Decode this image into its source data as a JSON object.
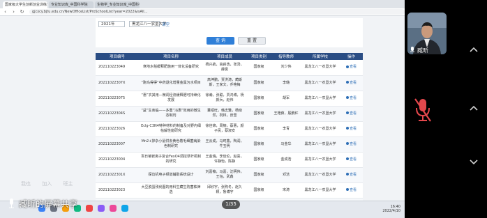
{
  "browser": {
    "tabs": [
      {
        "label": "国家级大学生创新创业训练计划"
      },
      {
        "label": "专业知识库_中国科学院"
      },
      {
        "label": "生物学_专业知识库_中国科学院"
      }
    ],
    "url": "gjcxcy.bjtu.edu.cn/NewOfficeList/ProSchoolList?year=2022&isAll..."
  },
  "filter": {
    "year_value": "2021年",
    "school_value": "黑龙江八一农垦大学",
    "clear_label": "清空",
    "query_label": "查 询",
    "reset_label": "重 置"
  },
  "table": {
    "headers": [
      "项目编号",
      "项目名称",
      "项目成员",
      "项目类别",
      "指导教师",
      "所属学校",
      "操作"
    ],
    "view_label": "查看",
    "rows": [
      {
        "id": "202110223049",
        "name": "寒地水稻缓释肥施用一体化设备研究",
        "members": "杨兴航，高斜浩，张汤，薛雯",
        "category": "国家级",
        "advisor": "刘少伟",
        "school": "黑龙江八一农垦大学"
      },
      {
        "id": "20211022307X",
        "name": "“跑鸟得得”中药退化增量金属污水项目",
        "members": "高坤鹏，贾洪涛，蔺斯斯，王家文，乔艳梅",
        "category": "国家级",
        "advisor": "李璐",
        "school": "黑龙江八一农垦大学"
      },
      {
        "id": "202110223075",
        "name": "“惠”农其用—微调径流缓释肥可持续化发展",
        "members": "徐瀚，张聪，贾鸿博，杨颜兵，赵伟",
        "category": "国家级",
        "advisor": "胡军",
        "school": "黑龙江八一农垦大学"
      },
      {
        "id": "20211022304S",
        "name": "“益”生亲临——多重“冯惠”效用的微生态制剂",
        "members": "董绍旺，韩志雅，杨晓然，祝林，张雪",
        "category": "国家级",
        "advisor": "王艳茹，殷鹏红",
        "school": "黑龙江八一农垦大学"
      },
      {
        "id": "202110223026",
        "name": "Eclg-C3N4特种材料的制备及对野内细枯解性能研究",
        "members": "徐佳锦，周楠，蔡蕙，颜子民，蔡淑安",
        "category": "国家级",
        "advisor": "李青",
        "school": "黑龙江八一农垦大学"
      },
      {
        "id": "202110223007",
        "name": "Mn2+掺杂小鼠供去黄色着毛细菌病染色制研究",
        "members": "王云成，马珂鑫，陶润，牛玉明",
        "category": "国家级",
        "advisor": "马金华",
        "school": "黑龙江八一农垦大学"
      },
      {
        "id": "202110223004",
        "name": "百日菊镁离子复合FexO4调控草杆机制的研究",
        "members": "王金瑞，李佳伦，赵喜，许静怡，陈静",
        "category": "国家级",
        "advisor": "金成浩",
        "school": "黑龙江八一农垦大学"
      },
      {
        "id": "20211022301X",
        "name": "探访机电子频道辅助系统设计",
        "members": "刘嘉薇，马嘉，沈明伟，王钰，武鑫",
        "category": "国家级",
        "advisor": "邓洁",
        "school": "黑龙江八一农垦大学"
      },
      {
        "id": "202110223023",
        "name": "大豆脱蛋残伐图的用科生藏生防菌株筛选",
        "members": "邱欣宇，张煦冬，赵久颖，鲁博宇",
        "category": "国家级",
        "advisor": "宋涛",
        "school": "黑龙江八一农垦大学"
      },
      {
        "id": "20211022303X",
        "name": "敏捷终端数据监测服务",
        "members": "刘思宏，郭新卓，",
        "category": "国家级",
        "advisor": "赵露",
        "school": "黑龙江八一农垦大学"
      }
    ]
  },
  "overlay": {
    "sharer_faint": [
      "我也",
      "加入",
      "班主"
    ]
  },
  "taskbar": {
    "time": "16:40",
    "date": "2022/4/10"
  },
  "meeting": {
    "share_status": "臧昕的屏幕共享",
    "page_indicator": "1/35",
    "participant_name": "臧昕"
  },
  "colors": {
    "table_header": "#2a4d84",
    "link": "#2f6fb6",
    "query_button": "#2f7fd8",
    "meeting_bg": "#000000"
  },
  "icons": [
    "mic-icon",
    "chevron-up-icon",
    "chevron-down-icon",
    "mute-mic-icon",
    "view-icon"
  ]
}
